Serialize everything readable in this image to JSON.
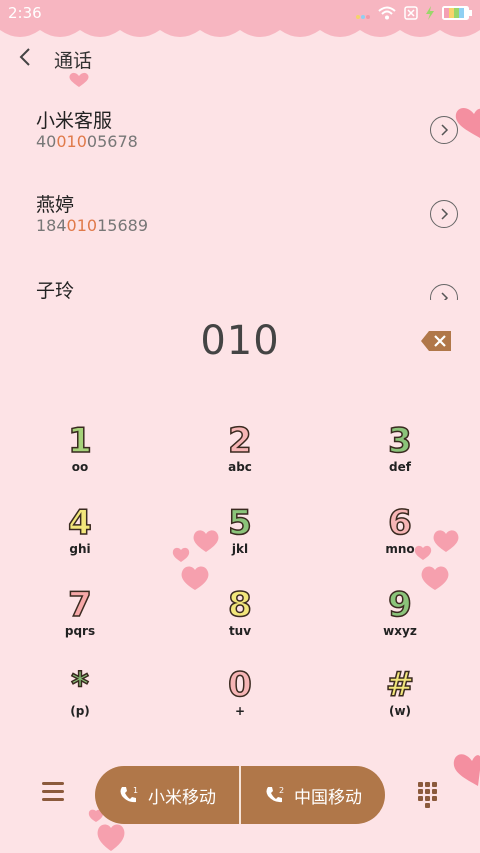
{
  "status_bar": {
    "time": "2:36"
  },
  "header": {
    "title": "通话"
  },
  "contacts": [
    {
      "name": "小米客服",
      "num_pre": "40",
      "num_match": "010",
      "num_post": "05678"
    },
    {
      "name": "燕婷",
      "num_pre": "184",
      "num_match": "010",
      "num_post": "15689"
    },
    {
      "name": "子玲",
      "num_pre": "",
      "num_match": "",
      "num_post": ""
    }
  ],
  "dial": {
    "value": "010"
  },
  "keypad": [
    {
      "digit": "1",
      "letters": "oo",
      "color": "#a6d27a"
    },
    {
      "digit": "2",
      "letters": "abc",
      "color": "#f6b5b5"
    },
    {
      "digit": "3",
      "letters": "def",
      "color": "#8bc47a"
    },
    {
      "digit": "4",
      "letters": "ghi",
      "color": "#f2e67b"
    },
    {
      "digit": "5",
      "letters": "jkl",
      "color": "#8bc47a"
    },
    {
      "digit": "6",
      "letters": "mno",
      "color": "#f6b5b5"
    },
    {
      "digit": "7",
      "letters": "pqrs",
      "color": "#f6a8a8"
    },
    {
      "digit": "8",
      "letters": "tuv",
      "color": "#f2e67b"
    },
    {
      "digit": "9",
      "letters": "wxyz",
      "color": "#8bc47a"
    },
    {
      "digit": "*",
      "letters": "(p)",
      "color": "#8bc47a"
    },
    {
      "digit": "0",
      "letters": "+",
      "color": "#f6b5b5"
    },
    {
      "digit": "#",
      "letters": "(w)",
      "color": "#f2e67b"
    }
  ],
  "bottom": {
    "sim1_label": "小米移动",
    "sim2_label": "中国移动",
    "sim1_index": "1",
    "sim2_index": "2"
  },
  "colors": {
    "accent": "#b07749",
    "background": "#fde3e6",
    "highlight": "#e07a4a"
  }
}
